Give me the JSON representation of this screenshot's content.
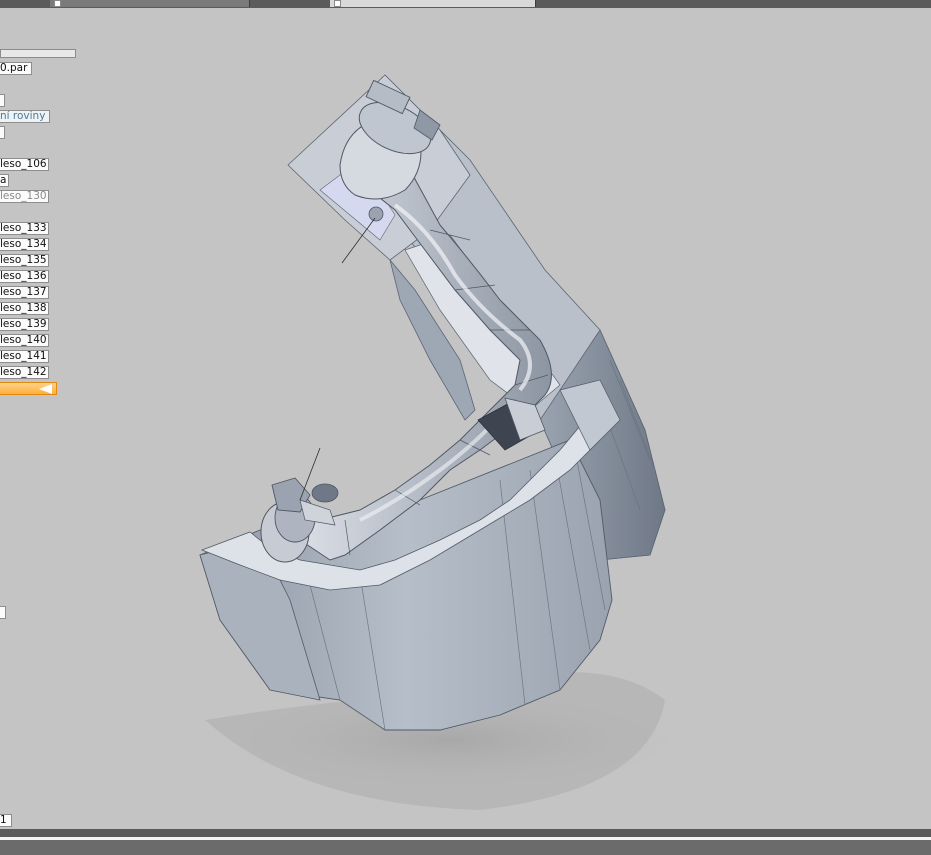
{
  "tabs": [
    {
      "label": "",
      "active": false
    },
    {
      "label": "",
      "active": true
    }
  ],
  "tree": {
    "file": "0.par",
    "reference_planes": "ní roviny",
    "items": [
      {
        "label": "leso_106",
        "muted": false
      },
      {
        "label": "a",
        "muted": false
      },
      {
        "label": "leso_130",
        "muted": true
      },
      {
        "label": "leso_133",
        "muted": false
      },
      {
        "label": "leso_134",
        "muted": false
      },
      {
        "label": "leso_135",
        "muted": false
      },
      {
        "label": "leso_136",
        "muted": false
      },
      {
        "label": "leso_137",
        "muted": false
      },
      {
        "label": "leso_138",
        "muted": false
      },
      {
        "label": "leso_139",
        "muted": false
      },
      {
        "label": "leso_140",
        "muted": false
      },
      {
        "label": "leso_141",
        "muted": false
      },
      {
        "label": "leso_142",
        "muted": false
      }
    ],
    "selected": {
      "label": "",
      "icon": "rollback-arrow-icon"
    }
  },
  "status": {
    "counter": "1"
  },
  "colors": {
    "viewport_bg": "#c4c4c4",
    "part_face": "#a7b0bd",
    "part_top": "#dde1e8",
    "selection_accent": "#ffae3a"
  }
}
